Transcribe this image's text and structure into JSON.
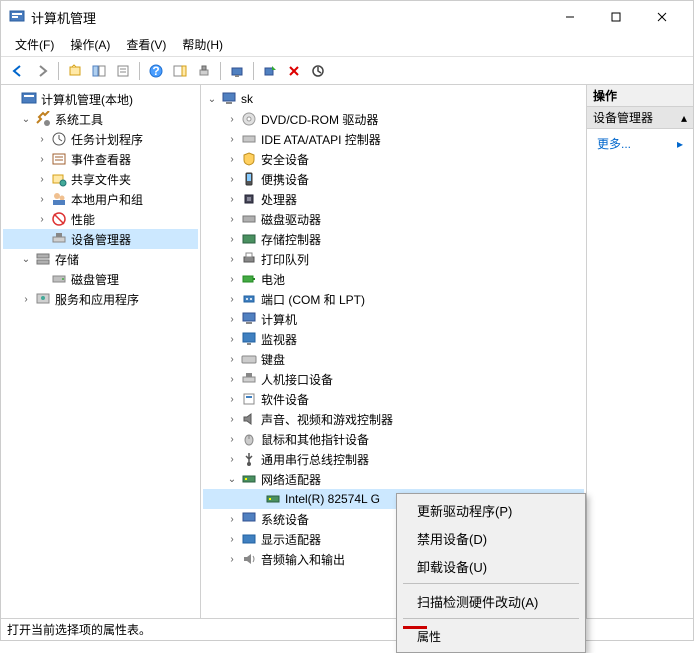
{
  "window": {
    "title": "计算机管理"
  },
  "menubar": {
    "file": "文件(F)",
    "action": "操作(A)",
    "view": "查看(V)",
    "help": "帮助(H)"
  },
  "left_tree": {
    "root": "计算机管理(本地)",
    "system_tools": "系统工具",
    "task_scheduler": "任务计划程序",
    "event_viewer": "事件查看器",
    "shared_folders": "共享文件夹",
    "local_users": "本地用户和组",
    "performance": "性能",
    "device_manager": "设备管理器",
    "storage": "存储",
    "disk_mgmt": "磁盘管理",
    "services_apps": "服务和应用程序"
  },
  "mid_tree": {
    "root": "sk",
    "dvd": "DVD/CD-ROM 驱动器",
    "ide": "IDE ATA/ATAPI 控制器",
    "security": "安全设备",
    "portable": "便携设备",
    "cpu": "处理器",
    "disk_drive": "磁盘驱动器",
    "storage_ctrl": "存储控制器",
    "print_queue": "打印队列",
    "battery": "电池",
    "ports": "端口 (COM 和 LPT)",
    "computer": "计算机",
    "monitor": "监视器",
    "keyboard": "键盘",
    "hid": "人机接口设备",
    "software": "软件设备",
    "audio_video": "声音、视频和游戏控制器",
    "mouse": "鼠标和其他指针设备",
    "usb_serial": "通用串行总线控制器",
    "network": "网络适配器",
    "intel_nic": "Intel(R) 82574L G",
    "system_devices": "系统设备",
    "display": "显示适配器",
    "audio_io": "音频输入和输出"
  },
  "right_pane": {
    "header": "操作",
    "sub": "设备管理器",
    "more": "更多..."
  },
  "context_menu": {
    "update_driver": "更新驱动程序(P)",
    "disable": "禁用设备(D)",
    "uninstall": "卸载设备(U)",
    "scan_hw": "扫描检测硬件改动(A)",
    "properties": "属性"
  },
  "statusbar": {
    "text": "打开当前选择项的属性表。"
  }
}
